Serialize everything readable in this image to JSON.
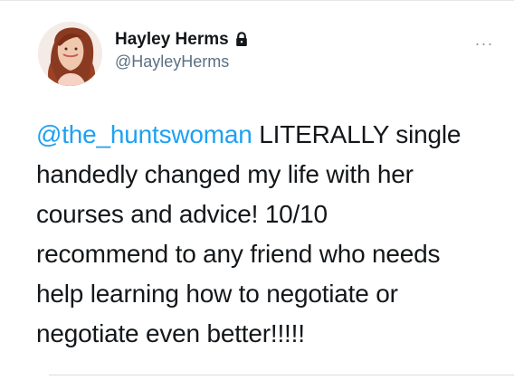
{
  "tweet": {
    "author": {
      "display_name": "Hayley Herms",
      "handle": "@HayleyHerms",
      "protected_icon": "lock-icon"
    },
    "more_icon": "more-horizontal-icon",
    "body": {
      "mention": "@the_huntswoman",
      "lines": [
        " LITERALLY single",
        "handedly changed my life with her",
        "courses and advice! 10/10",
        "recommend to any friend who needs",
        "help learning how to negotiate or",
        "negotiate even better!!!!!"
      ]
    }
  },
  "colors": {
    "text": "#14171a",
    "secondary_text": "#5b7083",
    "mention": "#1da1f2",
    "background": "#ffffff"
  }
}
